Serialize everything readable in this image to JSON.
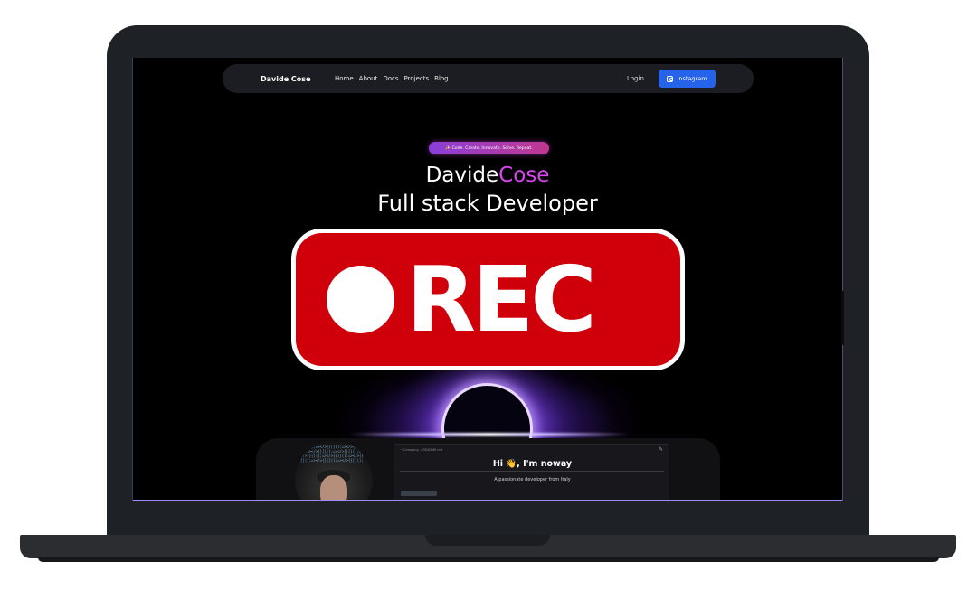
{
  "navbar": {
    "brand": "Davide Cose",
    "links": [
      "Home",
      "About",
      "Docs",
      "Projects",
      "Blog"
    ],
    "login_label": "Login",
    "instagram_label": "Instagram",
    "instagram_color": "#2563eb"
  },
  "hero": {
    "tagline": "✨ Code. Create. Innovate. Solve. Repeat.",
    "title_main": "Davide",
    "title_accent": "Cose",
    "subtitle": "Full stack Developer",
    "accent_color": "#d946ef"
  },
  "profile_card": {
    "terminal_title": "~/Company :: README.md",
    "greeting": "Hi 👋, I'm noway",
    "description": "A passionate developer from Italy"
  },
  "overlay": {
    "label": "REC",
    "color": "#d0000b"
  }
}
